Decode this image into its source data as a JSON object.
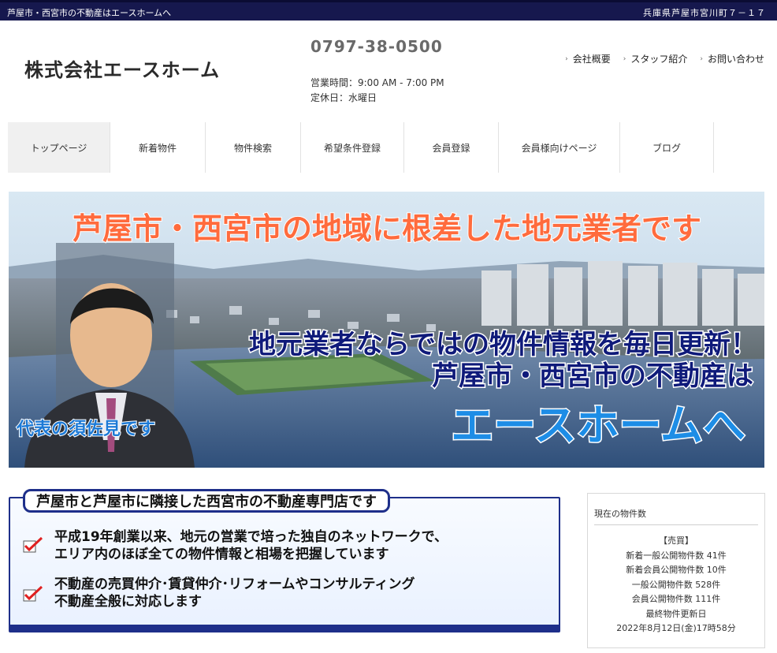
{
  "topbar": {
    "tagline": "芦屋市・西宮市の不動産はエースホームへ",
    "address": "兵庫県芦屋市宮川町７－１７"
  },
  "header": {
    "company_name": "株式会社エースホーム",
    "phone": "0797-38-0500",
    "hours": "営業時間：9:00 AM - 7:00 PM",
    "closed": "定休日：水曜日",
    "links": [
      {
        "label": "会社概要",
        "icon": "chevron-right-icon"
      },
      {
        "label": "スタッフ紹介",
        "icon": "chevron-right-icon"
      },
      {
        "label": "お問い合わせ",
        "icon": "chevron-right-icon"
      }
    ]
  },
  "nav": {
    "items": [
      {
        "label": "トップページ"
      },
      {
        "label": "新着物件"
      },
      {
        "label": "物件検索"
      },
      {
        "label": "希望条件登録"
      },
      {
        "label": "会員登録"
      },
      {
        "label": "会員様向けページ"
      },
      {
        "label": "ブログ"
      }
    ]
  },
  "hero": {
    "headline": "芦屋市・西宮市の地域に根差した地元業者です",
    "line1": "地元業者ならではの物件情報を毎日更新！",
    "line2": "芦屋市・西宮市の不動産は",
    "brand": "エースホームへ",
    "caption": "代表の須佐見です",
    "colors": {
      "headline": "#ff6b3d",
      "line": "#0f1a7a",
      "brand": "#1d8de6",
      "caption": "#1d7ad6"
    }
  },
  "feature": {
    "title": "芦屋市と芦屋市に隣接した西宮市の不動産専門店です",
    "point1_line1": "平成19年創業以来、地元の営業で培った独自のネットワークで、",
    "point1_line2": "エリア内のほぼ全ての物件情報と相場を把握しています",
    "point2_line1": "不動産の売買仲介･賃貸仲介･リフォームやコンサルティング",
    "point2_line2": "不動産全般に対応します",
    "check_icon": "checkmark-icon",
    "check_color": "#e02020"
  },
  "counts": {
    "title": "現在の物件数",
    "section": "【売買】",
    "rows": [
      "新着一般公開物件数 41件",
      "新着会員公開物件数 10件",
      "一般公開物件数 528件",
      "会員公開物件数 111件",
      "最終物件更新日",
      "2022年8月12日(金)17時58分"
    ]
  }
}
